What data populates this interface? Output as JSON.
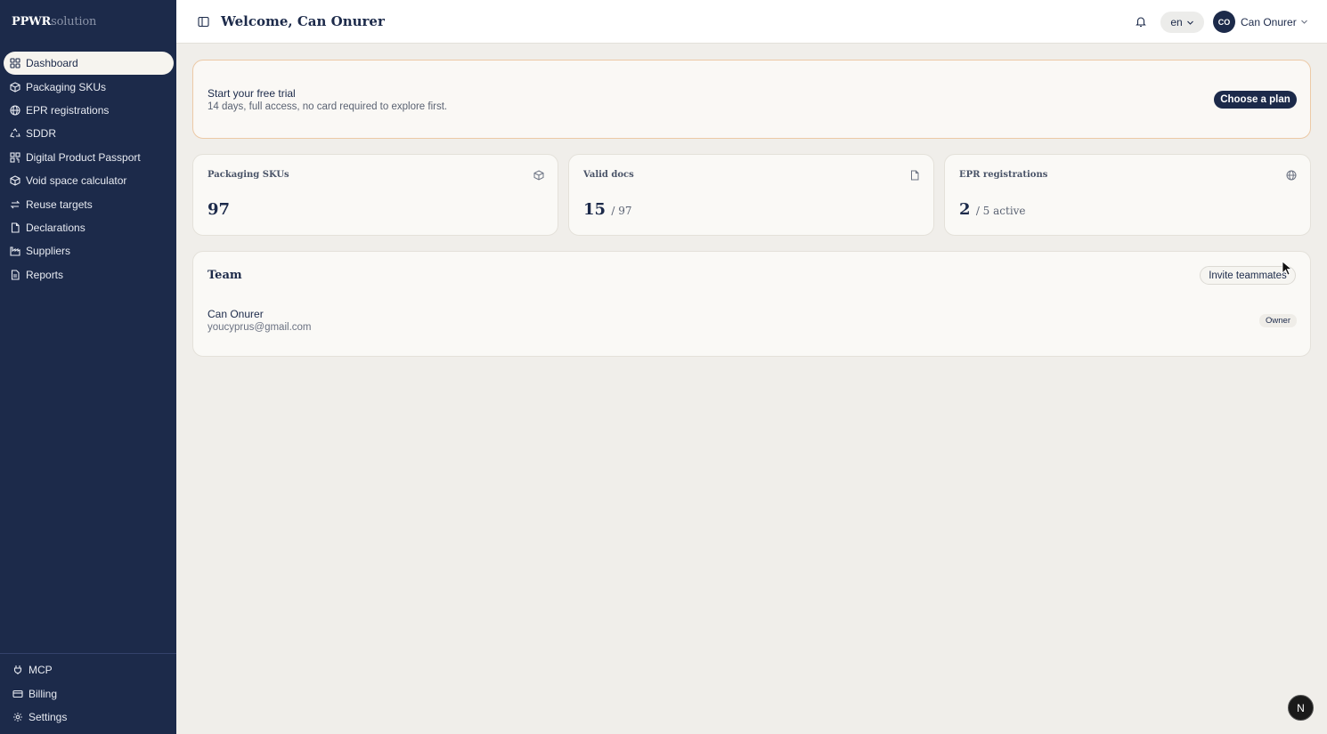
{
  "brand": {
    "bold": "PPWR",
    "light": "solution"
  },
  "sidebar": {
    "items": [
      {
        "label": "Dashboard",
        "icon": "grid-icon",
        "active": true
      },
      {
        "label": "Packaging SKUs",
        "icon": "box-icon"
      },
      {
        "label": "EPR registrations",
        "icon": "globe-icon"
      },
      {
        "label": "SDDR",
        "icon": "recycle-icon"
      },
      {
        "label": "Digital Product Passport",
        "icon": "qr-icon"
      },
      {
        "label": "Void space calculator",
        "icon": "box-icon"
      },
      {
        "label": "Reuse targets",
        "icon": "repeat-icon"
      },
      {
        "label": "Declarations",
        "icon": "document-icon"
      },
      {
        "label": "Suppliers",
        "icon": "factory-icon"
      },
      {
        "label": "Reports",
        "icon": "report-icon"
      }
    ],
    "bottom": [
      {
        "label": "MCP",
        "icon": "plug-icon"
      },
      {
        "label": "Billing",
        "icon": "card-icon"
      },
      {
        "label": "Settings",
        "icon": "gear-icon"
      }
    ]
  },
  "header": {
    "title": "Welcome, Can Onurer",
    "language": "en",
    "avatar_initials": "CO",
    "user_name": "Can Onurer"
  },
  "trial": {
    "title": "Start your free trial",
    "subtitle": "14 days, full access, no card required to explore first.",
    "button": "Choose a plan"
  },
  "stats": [
    {
      "label": "Packaging SKUs",
      "value": "97",
      "suffix": "",
      "icon": "box-icon"
    },
    {
      "label": "Valid docs",
      "value": "15",
      "suffix": "/ 97",
      "icon": "document-icon"
    },
    {
      "label": "EPR registrations",
      "value": "2",
      "suffix": "/ 5 active",
      "icon": "globe-icon"
    }
  ],
  "team": {
    "title": "Team",
    "invite_button": "Invite teammates",
    "members": [
      {
        "name": "Can Onurer",
        "email": "youcyprus@gmail.com",
        "role": "Owner"
      }
    ]
  },
  "fab_label": "N",
  "colors": {
    "sidebar": "#1c2a4a",
    "accent": "#1c2a4a",
    "trial_border": "#ecc9a6",
    "page_bg": "#f0eeea"
  }
}
